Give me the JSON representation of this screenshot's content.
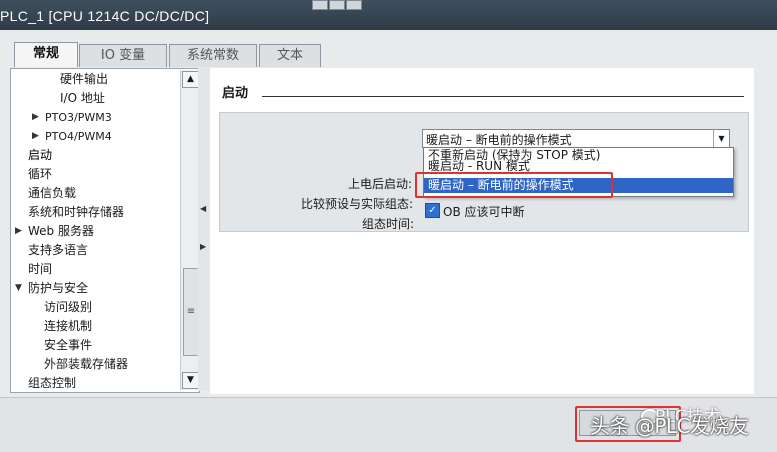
{
  "window": {
    "title": "PLC_1 [CPU 1214C DC/DC/DC]"
  },
  "tabs": [
    {
      "label": "常规"
    },
    {
      "label": "IO 变量"
    },
    {
      "label": "系统常数"
    },
    {
      "label": "文本"
    }
  ],
  "nav": {
    "items": [
      {
        "label": "硬件输出"
      },
      {
        "label": "I/O 地址"
      },
      {
        "label": "PTO3/PWM3"
      },
      {
        "label": "PTO4/PWM4"
      },
      {
        "label": "启动"
      },
      {
        "label": "循环"
      },
      {
        "label": "通信负载"
      },
      {
        "label": "系统和时钟存储器"
      },
      {
        "label": "Web 服务器"
      },
      {
        "label": "支持多语言"
      },
      {
        "label": "时间"
      },
      {
        "label": "防护与安全"
      },
      {
        "label": "访问级别"
      },
      {
        "label": "连接机制"
      },
      {
        "label": "安全事件"
      },
      {
        "label": "外部装载存储器"
      },
      {
        "label": "组态控制"
      }
    ]
  },
  "section": {
    "title": "启动",
    "fields": {
      "startup_label": "上电后启动:",
      "compare_label": "比较预设与实际组态:",
      "config_time_label": "组态时间:",
      "startup_value": "暖启动 – 断电前的操作模式"
    },
    "dropdown_options": [
      "不重新启动 (保持为 STOP 模式)",
      "暖启动 - RUN 模式",
      "暖启动 – 断电前的操作模式"
    ],
    "checkbox_label": "OB 应该可中断",
    "checkbox_checked": true
  },
  "watermark": {
    "line1": "头条 @PLC发烧友",
    "line2": "PLC技术"
  },
  "colors": {
    "highlight": "#2f66c5",
    "annotation": "#e03131",
    "titlebar": "#34424f"
  }
}
